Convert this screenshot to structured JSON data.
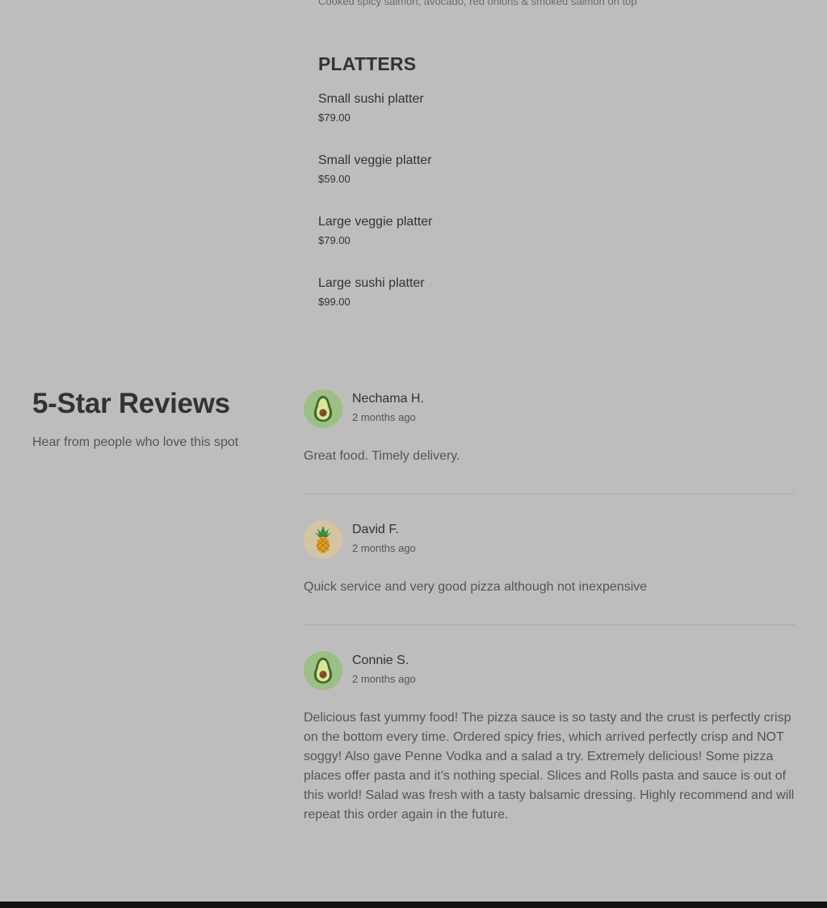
{
  "menu": {
    "previous_item_description": "Cooked spicy salmon, avocado, red onions & smoked salmon on top",
    "section_title": "PLATTERS",
    "items": [
      {
        "name": "Small sushi platter",
        "price": "$79.00"
      },
      {
        "name": "Small veggie platter",
        "price": "$59.00"
      },
      {
        "name": "Large veggie platter",
        "price": "$79.00"
      },
      {
        "name": "Large sushi platter",
        "price": "$99.00"
      }
    ]
  },
  "reviews": {
    "heading": "5-Star Reviews",
    "subheading": "Hear from people who love this spot",
    "items": [
      {
        "avatar_icon": "avocado-icon",
        "avatar_bg": "#9bbf85",
        "name": "Nechama H.",
        "date": "2 months ago",
        "text": "Great food. Timely delivery."
      },
      {
        "avatar_icon": "pineapple-icon",
        "avatar_bg": "#d3c5a2",
        "name": "David F.",
        "date": "2 months ago",
        "text": "Quick service and very good pizza although not inexpensive"
      },
      {
        "avatar_icon": "avocado-icon",
        "avatar_bg": "#9bbf85",
        "name": "Connie S.",
        "date": "2 months ago",
        "text": "Delicious fast yummy food! The pizza sauce is so tasty and the crust is perfectly crisp on the bottom every time. Ordered spicy fries, which arrived perfectly crisp and NOT soggy! Also gave Penne Vodka and a salad a try. Extremely delicious! Some pizza places offer pasta and it’s nothing special. Slices and Rolls pasta and sauce is out of this world! Salad was fresh with a tasty balsamic dressing. Highly recommend and will repeat this order again in the future."
      }
    ]
  },
  "colors": {
    "page_background": "#bdbdbd",
    "text_primary": "#333333",
    "text_secondary": "#555555",
    "divider": "#a9a9a9",
    "footer": "#111111"
  }
}
